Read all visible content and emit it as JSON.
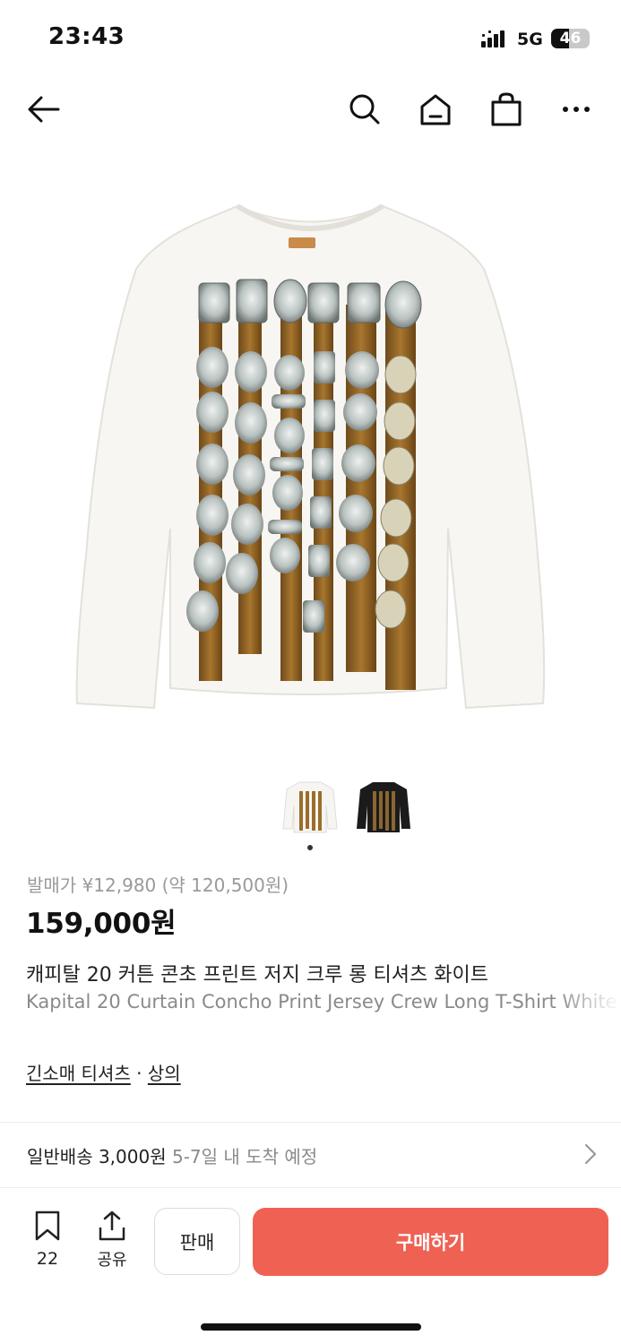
{
  "status_bar": {
    "time": "23:43",
    "network": "5G",
    "battery": "46",
    "battery_level": 0.46
  },
  "nav": {
    "icons": [
      "back-arrow-icon",
      "search-icon",
      "home-icon",
      "shopping-bag-icon",
      "more-icon"
    ]
  },
  "gallery": {
    "thumbnails": [
      "white-tshirt-thumbnail",
      "black-tshirt-thumbnail"
    ],
    "current_index": 1
  },
  "product": {
    "release_price": "발매가 ¥12,980 (약 120,500원)",
    "price": "159,000원",
    "title_ko": "캐피탈 20 커튼 콘초 프린트 저지 크루 롱 티셔츠 화이트",
    "title_en": "Kapital 20 Curtain Concho Print Jersey Crew Long T-Shirt White",
    "category_1": "긴소매 티셔츠",
    "category_separator": "·",
    "category_2": "상의"
  },
  "shipping": {
    "main": "일반배송 3,000원",
    "sub": "5-7일 내 도착 예정"
  },
  "bottom_bar": {
    "bookmark_count": "22",
    "share_label": "공유",
    "sell_label": "판매",
    "buy_label": "구매하기"
  },
  "colors": {
    "accent": "#ef6253",
    "text": "#111111",
    "muted": "#8a8a8a"
  }
}
